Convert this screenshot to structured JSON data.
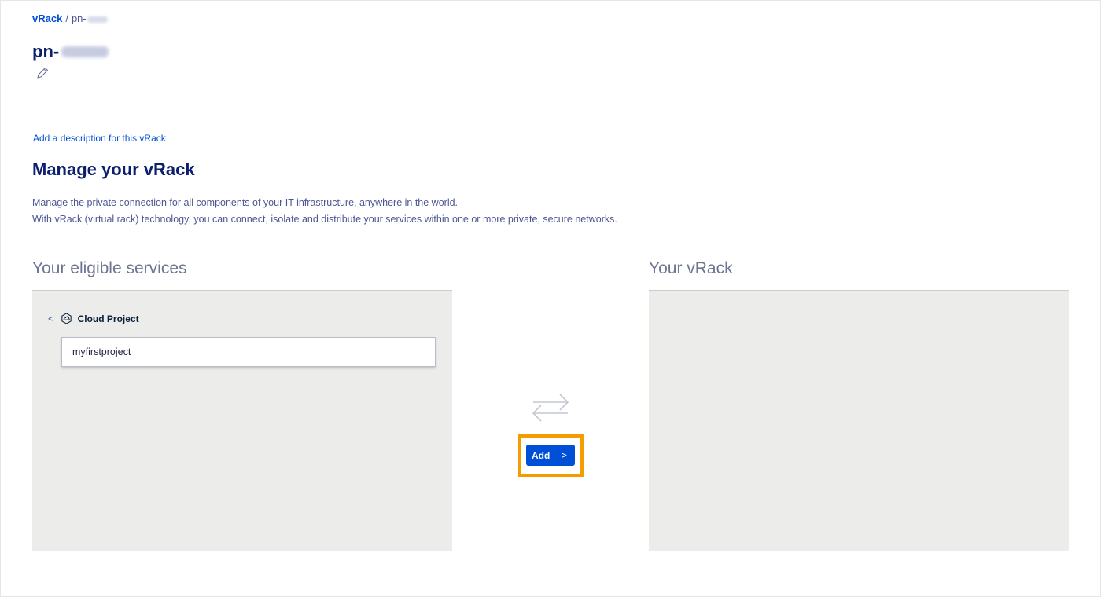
{
  "breadcrumb": {
    "root": "vRack",
    "separator": "/",
    "current": "pn-"
  },
  "header": {
    "title": "pn-"
  },
  "description": {
    "add_link": "Add a description for this vRack"
  },
  "manage": {
    "title": "Manage your vRack",
    "intro_line1": "Manage the private connection for all components of your IT infrastructure, anywhere in the world.",
    "intro_line2": "With vRack (virtual rack) technology, you can connect, isolate and distribute your services within one or more private, secure networks."
  },
  "eligible": {
    "title": "Your eligible services",
    "back_label": "<",
    "category": "Cloud Project",
    "items": [
      "myfirstproject"
    ]
  },
  "vrack": {
    "title": "Your vRack"
  },
  "actions": {
    "add_label": "Add",
    "add_chevron": ">"
  },
  "colors": {
    "brand_blue": "#0050d7",
    "title_navy": "#0b1f6e",
    "highlight_orange": "#f59c00",
    "panel_gray": "#ecedeb"
  },
  "icons": {
    "edit": "pencil-icon",
    "category": "cloud-project-icon",
    "transfer": "swap-arrows-icon",
    "back": "chevron-left-icon",
    "add": "chevron-right-icon"
  }
}
